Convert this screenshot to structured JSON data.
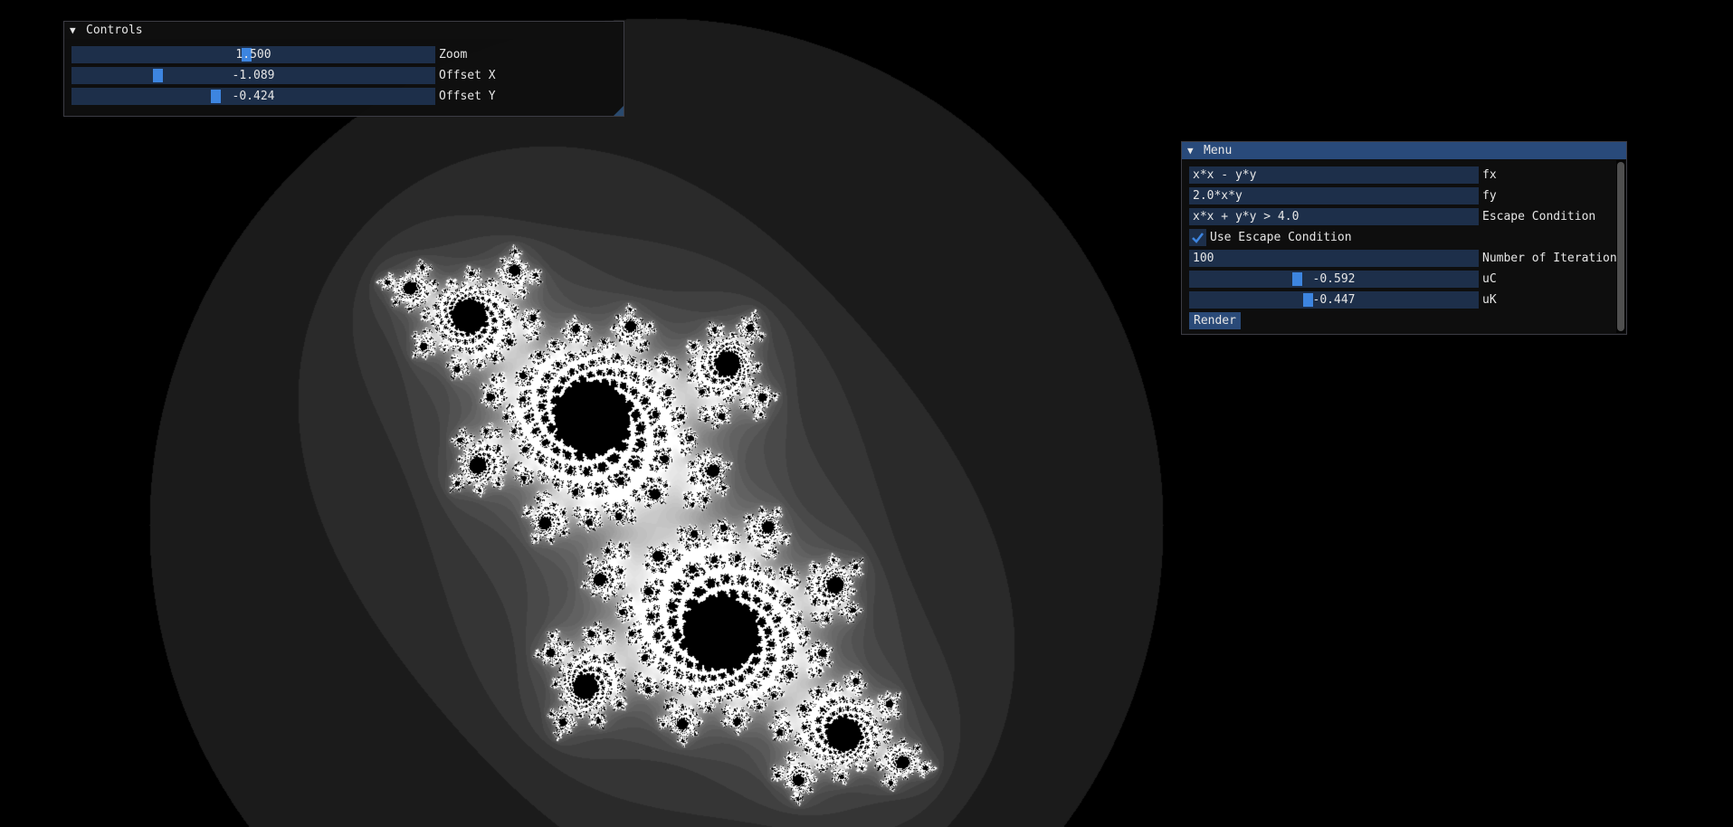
{
  "controls_window": {
    "title": "Controls",
    "zoom": {
      "value": "1.500",
      "label": "Zoom"
    },
    "offset_x": {
      "value": "-1.089",
      "label": "Offset X"
    },
    "offset_y": {
      "value": "-0.424",
      "label": "Offset Y"
    }
  },
  "menu_window": {
    "title": "Menu",
    "fx": {
      "value": "x*x - y*y",
      "label": "fx"
    },
    "fy": {
      "value": "2.0*x*y",
      "label": "fy"
    },
    "escape_condition": {
      "value": "x*x + y*y > 4.0",
      "label": "Escape Condition"
    },
    "use_escape": {
      "label": "Use Escape Condition",
      "checked": true
    },
    "iterations": {
      "value": "100",
      "label": "Number of Iterations"
    },
    "uC": {
      "value": "-0.592",
      "label": "uC"
    },
    "uK": {
      "value": "-0.447",
      "label": "uK"
    },
    "render_button": "Render"
  },
  "colors": {
    "window_bg": "#0f0f0f",
    "frame_bg": "#1d2f4a",
    "slider_grab": "#3d85e0",
    "title_active": "#294a7a",
    "fractal": "#ffffff"
  }
}
